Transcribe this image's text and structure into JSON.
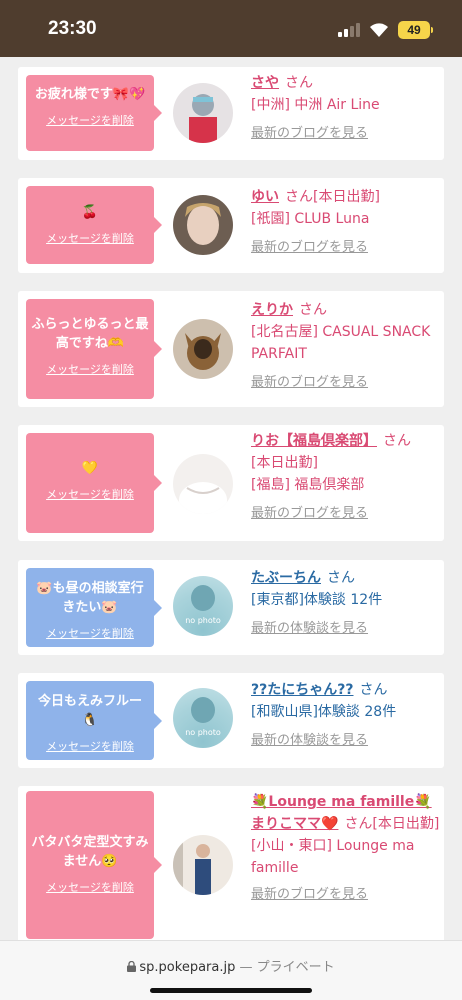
{
  "status_bar": {
    "time": "23:30",
    "battery": "49"
  },
  "cards": [
    {
      "bubble_text": "お疲れ様です🎀💖",
      "delete_label": "メッセージを削除",
      "name": "さや",
      "san": "さん",
      "detail_lines": [
        "[中洲] 中洲 Air Line"
      ],
      "link_label": "最新のブログを見る"
    },
    {
      "bubble_text": "🍒",
      "delete_label": "メッセージを削除",
      "name": "ゆい",
      "san": "さん[本日出勤]",
      "detail_lines": [
        "[祇園] CLUB Luna"
      ],
      "link_label": "最新のブログを見る"
    },
    {
      "bubble_text": "ふらっとゆるっと最高ですね🫶",
      "delete_label": "メッセージを削除",
      "name": "えりか",
      "san": "さん",
      "detail_lines": [
        "[北名古屋] CASUAL SNACK PARFAIT"
      ],
      "link_label": "最新のブログを見る"
    },
    {
      "bubble_text": "💛",
      "delete_label": "メッセージを削除",
      "name": "りお【福島倶楽部】",
      "san": "さん",
      "detail_lines": [
        "[本日出勤]",
        "[福島] 福島倶楽部"
      ],
      "link_label": "最新のブログを見る"
    },
    {
      "bubble_text": "🐷も昼の相談室行きたい🐷",
      "delete_label": "メッセージを削除",
      "name": "たぶーちん",
      "san": "さん",
      "detail_lines": [
        "[東京都]体験談 12件"
      ],
      "link_label": "最新の体験談を見る"
    },
    {
      "bubble_text": "今日もえみフルー🐧",
      "delete_label": "メッセージを削除",
      "name": "??たにちゃん??",
      "san": "さん",
      "detail_lines": [
        "[和歌山県]体験談 28件"
      ],
      "link_label": "最新の体験談を見る"
    },
    {
      "bubble_text": "バタバタ定型文すみません🥺",
      "delete_label": "メッセージを削除",
      "name": "💐Lounge ma famille💐まりこママ❤️",
      "san": "さん[本日出勤]",
      "detail_lines": [
        "[小山・東口] Lounge ma famille"
      ],
      "link_label": "最新のブログを見る"
    }
  ],
  "browser": {
    "url": "sp.pokepara.jp",
    "privacy": " — プライベート"
  },
  "colors": {
    "status_bar": "#4f3d2e",
    "pink": "#f58da3",
    "blue": "#8fb3ea",
    "name_pink": "#d94a73",
    "name_blue": "#2a6aa3"
  }
}
